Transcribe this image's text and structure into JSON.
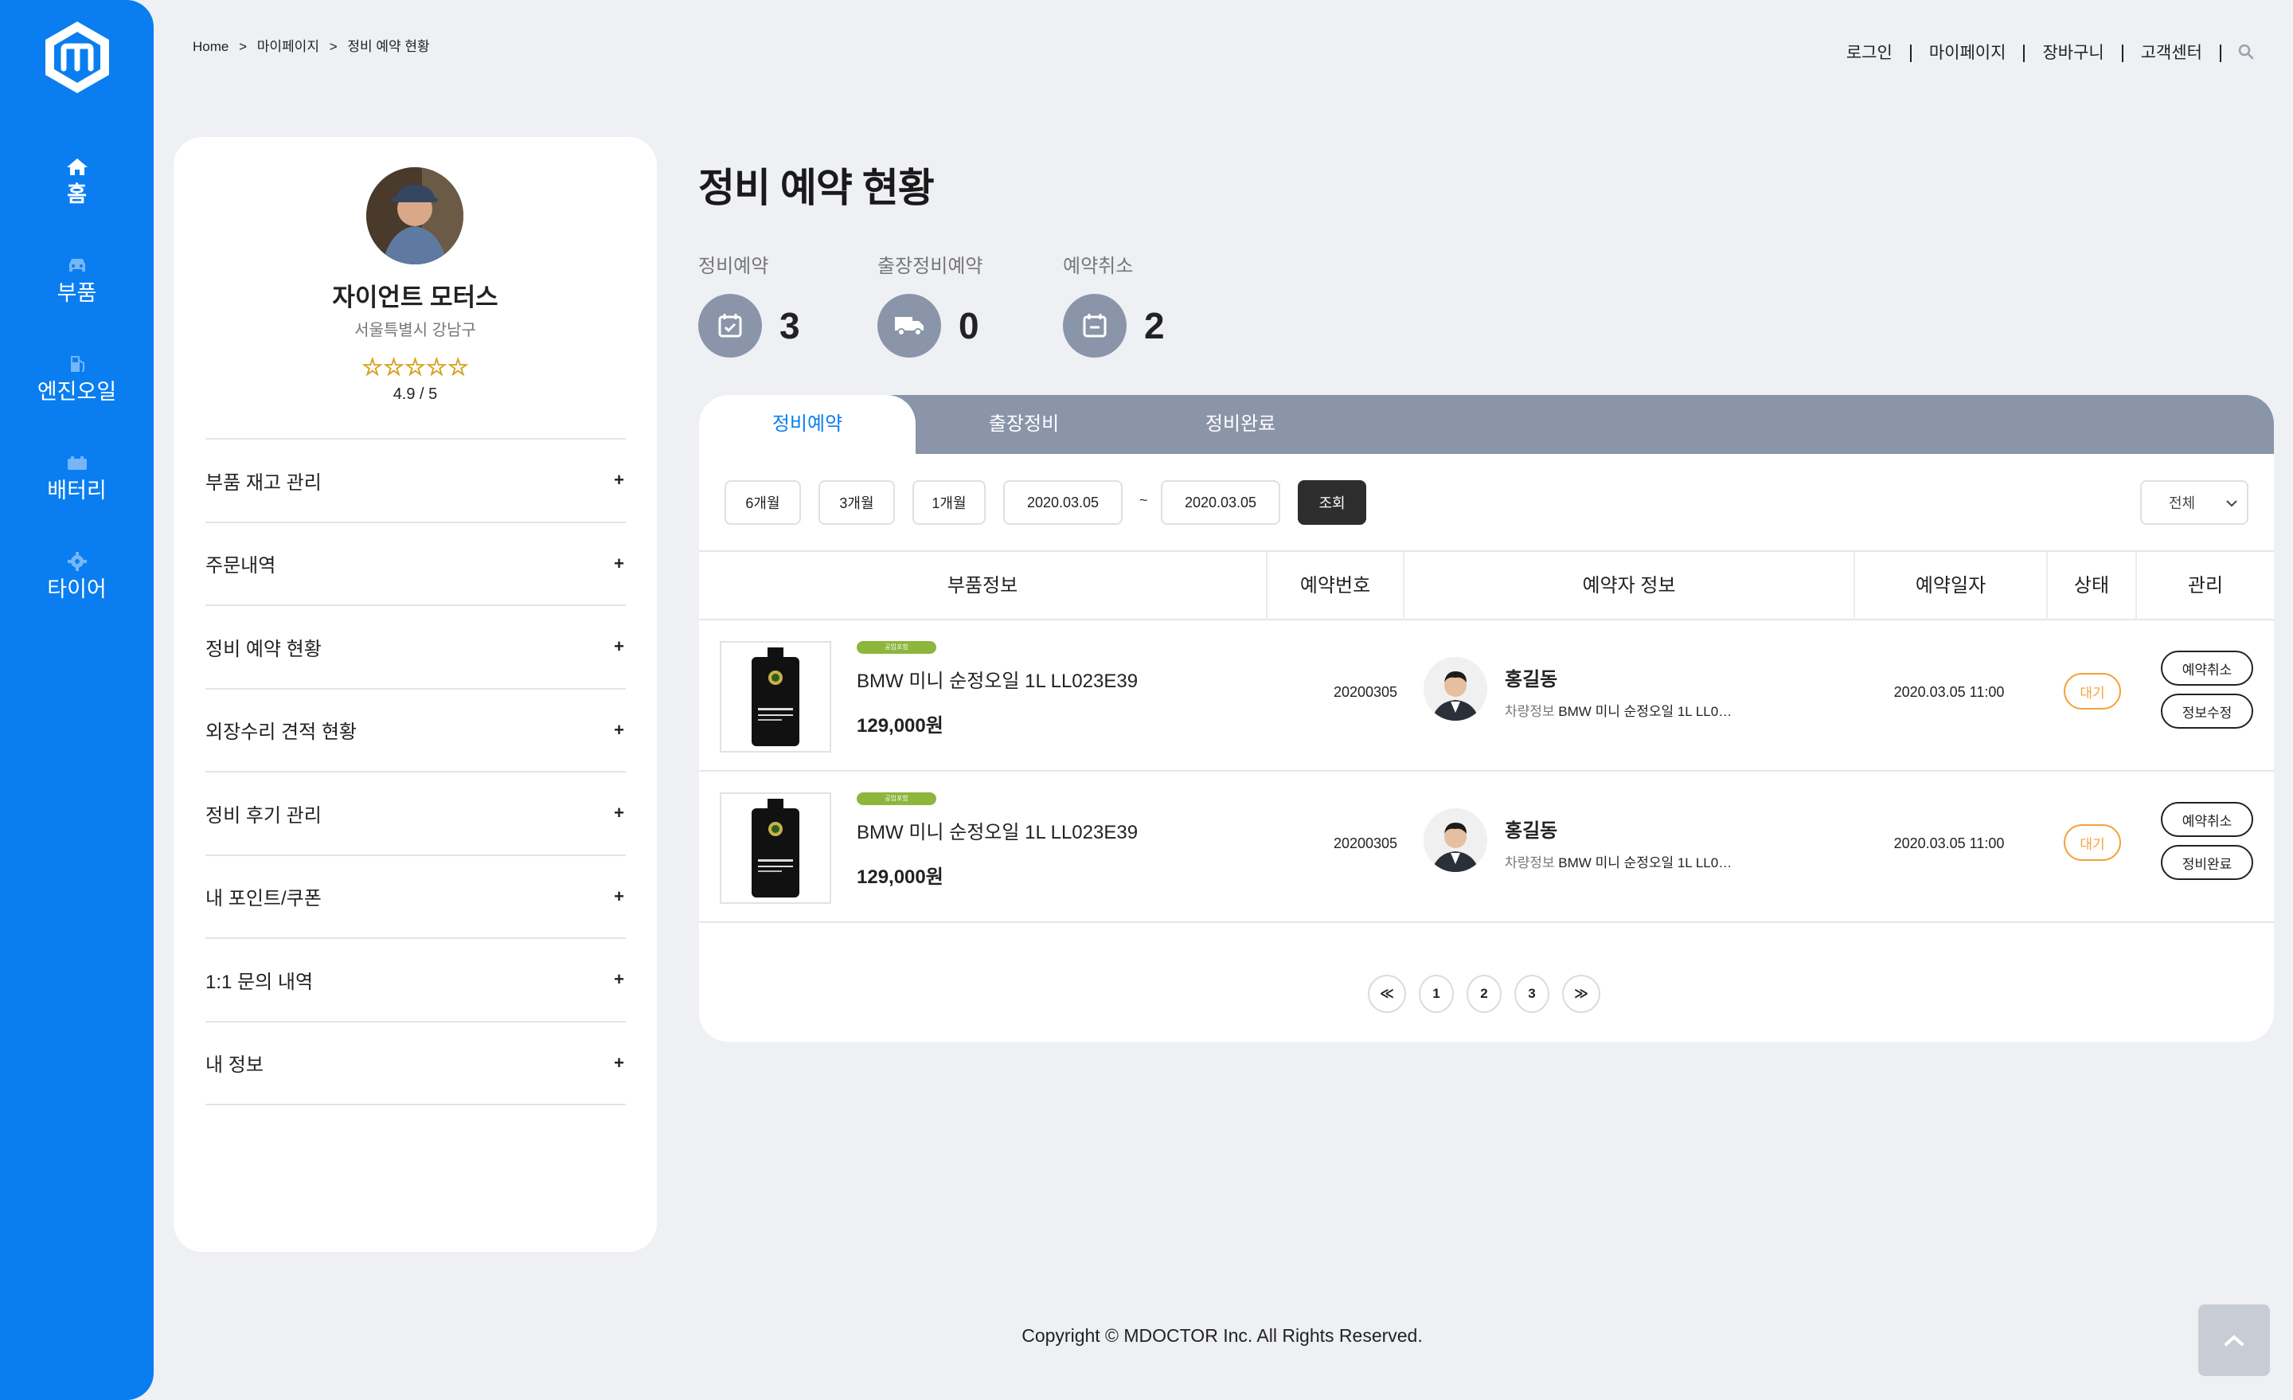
{
  "sidebar": {
    "items": [
      {
        "label": "홈",
        "icon": "home-icon"
      },
      {
        "label": "부품",
        "icon": "car-icon"
      },
      {
        "label": "엔진오일",
        "icon": "fuel-icon"
      },
      {
        "label": "배터리",
        "icon": "battery-icon"
      },
      {
        "label": "타이어",
        "icon": "gear-icon"
      }
    ]
  },
  "breadcrumb": [
    "Home",
    ">",
    "마이페이지",
    ">",
    "정비 예약 현황"
  ],
  "topnav": [
    "로그인",
    "마이페이지",
    "장바구니",
    "고객센터"
  ],
  "profile": {
    "name": "자이언트 모터스",
    "address": "서울특별시 강남구",
    "stars": "☆☆☆☆☆",
    "rating": "4.9 / 5",
    "rating_value": 4.9,
    "menu": [
      {
        "label": "부품 재고 관리",
        "plus": "+"
      },
      {
        "label": "주문내역",
        "plus": "+"
      },
      {
        "label": "정비 예약 현황",
        "plus": "+"
      },
      {
        "label": "외장수리 견적 현황",
        "plus": "+"
      },
      {
        "label": "정비 후기 관리",
        "plus": "+"
      },
      {
        "label": "내 포인트/쿠폰",
        "plus": "+"
      },
      {
        "label": "1:1 문의 내역",
        "plus": "+"
      },
      {
        "label": "내 정보",
        "plus": "+"
      }
    ]
  },
  "main": {
    "title": "정비 예약 현황",
    "stats": [
      {
        "label": "정비예약",
        "value": "3",
        "icon": "calendar-check-icon"
      },
      {
        "label": "출장정비예약",
        "value": "0",
        "icon": "truck-icon"
      },
      {
        "label": "예약취소",
        "value": "2",
        "icon": "calendar-minus-icon"
      }
    ],
    "tabs": [
      "정비예약",
      "출장정비",
      "정비완료"
    ],
    "filters": {
      "periods": [
        "6개월",
        "3개월",
        "1개월"
      ],
      "date_from": "2020.03.05",
      "tilde": "~",
      "date_to": "2020.03.05",
      "search": "조회",
      "select": "전체"
    },
    "table": {
      "headers": [
        "부품정보",
        "예약번호",
        "예약자 정보",
        "예약일자",
        "상태",
        "관리"
      ],
      "rows": [
        {
          "tag": "공임포함",
          "product": "BMW 미니 순정오일 1L LL023E39",
          "price": "129,000원",
          "reservation_no": "20200305",
          "customer": "홍길동",
          "vehicle_label": "차량정보",
          "vehicle": "BMW 미니 순정오일 1L LL0…",
          "date": "2020.03.05 11:00",
          "status": "대기",
          "actions": [
            "예약취소",
            "정보수정"
          ]
        },
        {
          "tag": "공임포함",
          "product": "BMW 미니 순정오일 1L LL023E39",
          "price": "129,000원",
          "reservation_no": "20200305",
          "customer": "홍길동",
          "vehicle_label": "차량정보",
          "vehicle": "BMW 미니 순정오일 1L LL0…",
          "date": "2020.03.05 11:00",
          "status": "대기",
          "actions": [
            "예약취소",
            "정비완료"
          ]
        }
      ]
    },
    "pagination": {
      "prev": "≪",
      "pages": [
        "1",
        "2",
        "3"
      ],
      "next": "≫"
    }
  },
  "footer": {
    "copyright": "Copyright © MDOCTOR Inc. All Rights Reserved."
  },
  "colors": {
    "brand": "#0a7ef0",
    "slate": "#8a95aa",
    "status_pending": "#f6a23a",
    "tag": "#8cb63c"
  }
}
